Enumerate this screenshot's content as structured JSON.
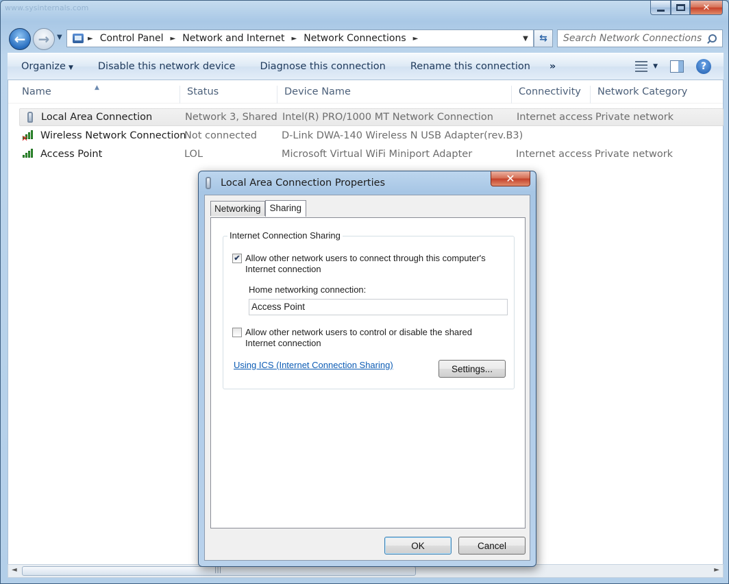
{
  "window": {
    "watermark": "www.sysinternals.com",
    "caption": {
      "minimize": "—",
      "maximize": "□",
      "close": "✕"
    }
  },
  "address": {
    "crumbs": [
      "Control Panel",
      "Network and Internet",
      "Network Connections"
    ],
    "separator": "►",
    "dropdown": "▼"
  },
  "search": {
    "placeholder": "Search Network Connections"
  },
  "toolbar": {
    "organize": "Organize",
    "disable": "Disable this network device",
    "diagnose": "Diagnose this connection",
    "rename": "Rename this connection",
    "more": "»"
  },
  "columns": {
    "name": "Name",
    "status": "Status",
    "device": "Device Name",
    "connectivity": "Connectivity",
    "category": "Network Category"
  },
  "connections": [
    {
      "name": "Local Area Connection",
      "status": "Network  3, Shared",
      "device": "Intel(R) PRO/1000 MT Network Connection",
      "connectivity": "Internet access",
      "category": "Private network",
      "icon": "ethernet-icon"
    },
    {
      "name": "Wireless Network Connection",
      "status": "Not connected",
      "device": "D-Link DWA-140 Wireless N USB Adapter(rev.B3)",
      "connectivity": "",
      "category": "",
      "icon": "wireless-disconnected-icon"
    },
    {
      "name": "Access Point",
      "status": "LOL",
      "device": "Microsoft Virtual WiFi Miniport Adapter",
      "connectivity": "Internet access",
      "category": "Private network",
      "icon": "wireless-icon"
    }
  ],
  "scrollbar": {
    "grip": "|||"
  },
  "dialog": {
    "title": "Local Area Connection Properties",
    "close": "✕",
    "tabs": [
      "Networking",
      "Sharing"
    ],
    "active_tab": "Sharing",
    "group_title": "Internet Connection Sharing",
    "allow_connect": {
      "label": "Allow other network users to connect through this computer's Internet connection",
      "checked": true,
      "mark": "✔"
    },
    "home_label": "Home networking connection:",
    "home_value": "Access Point",
    "allow_control": {
      "label": "Allow other network users to control or disable the shared Internet connection",
      "checked": false
    },
    "link": "Using ICS (Internet Connection Sharing)",
    "settings": "Settings...",
    "ok": "OK",
    "cancel": "Cancel"
  },
  "colors": {
    "accent": "#2a6fc0",
    "link": "#0b5bb4",
    "close_red": "#c7412a"
  }
}
